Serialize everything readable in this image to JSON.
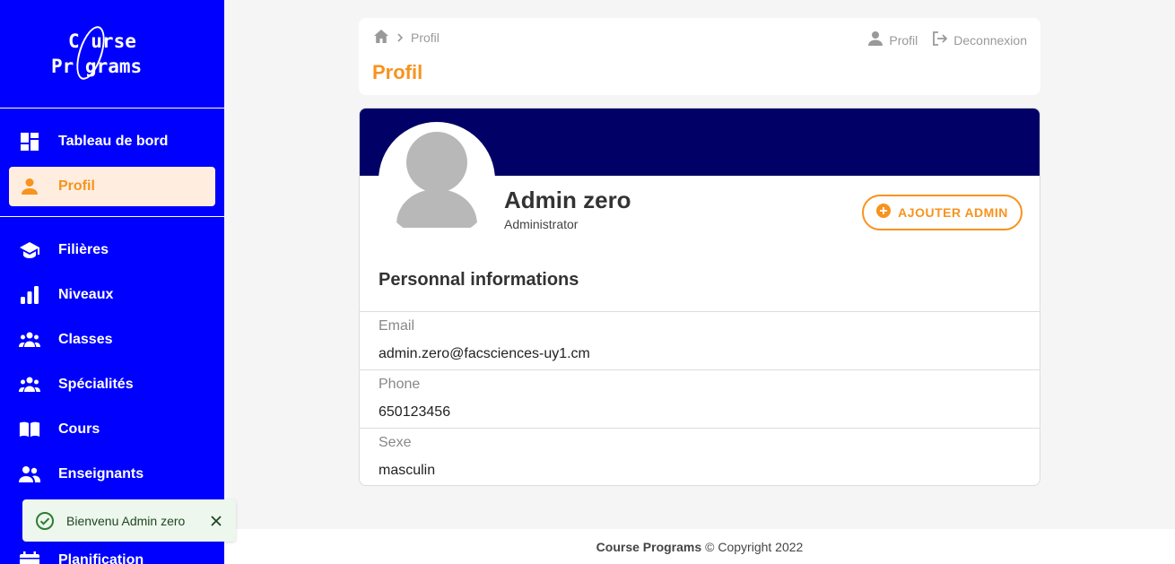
{
  "brand": {
    "line1": "C urse",
    "line2": "Pr grams"
  },
  "sidebar": {
    "items": [
      {
        "label": "Tableau de bord",
        "icon": "dashboard-icon"
      },
      {
        "label": "Profil",
        "icon": "person-icon",
        "active": true
      },
      {
        "label": "Filières",
        "icon": "graduation-cap-icon"
      },
      {
        "label": "Niveaux",
        "icon": "bar-chart-icon"
      },
      {
        "label": "Classes",
        "icon": "group-icon"
      },
      {
        "label": "Spécialités",
        "icon": "group-icon"
      },
      {
        "label": "Cours",
        "icon": "book-icon"
      },
      {
        "label": "Enseignants",
        "icon": "people-icon"
      },
      {
        "label": "Planification",
        "icon": "calendar-icon"
      }
    ]
  },
  "breadcrumb": {
    "current": "Profil"
  },
  "header": {
    "title": "Profil",
    "profile_link": "Profil",
    "logout_link": "Deconnexion"
  },
  "profile": {
    "name": "Admin zero",
    "role": "Administrator",
    "add_button": "AJOUTER ADMIN",
    "section_title": "Personnal informations",
    "fields": [
      {
        "label": "Email",
        "value": "admin.zero@facsciences-uy1.cm"
      },
      {
        "label": "Phone",
        "value": "650123456"
      },
      {
        "label": "Sexe",
        "value": "masculin"
      }
    ]
  },
  "footer": {
    "brand": "Course Programs",
    "copyright": "© Copyright 2022"
  },
  "toast": {
    "message": "Bienvenu Admin zero"
  },
  "colors": {
    "sidebar": "#0000ff",
    "accent": "#f7931e",
    "banner": "#000066",
    "toast_bg": "#edf7ed",
    "success": "#2e7d32"
  }
}
